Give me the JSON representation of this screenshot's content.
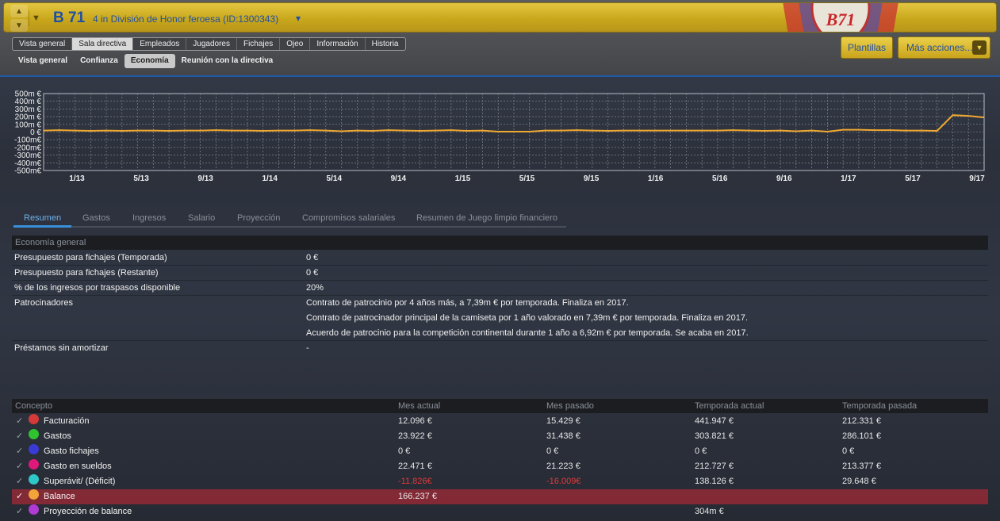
{
  "header": {
    "club_short": "B 71",
    "club_subtitle": "4 in  División de Honor feroesa  (ID:1300343)",
    "crest_text": "B71",
    "buttons": {
      "plantillas": "Plantillas",
      "mas_acciones": "Más acciones..."
    },
    "colors": {
      "title_bar": "#d4b52c",
      "title_text": "#1f4fa6"
    }
  },
  "main_tabs": [
    "Vista general",
    "Sala directiva",
    "Empleados",
    "Jugadores",
    "Fichajes",
    "Ojeo",
    "Información",
    "Historia"
  ],
  "main_tab_active": "Sala directiva",
  "sub_tabs": [
    "Vista general",
    "Confianza",
    "Economía",
    "Reunión con la directiva"
  ],
  "sub_tab_active": "Economía",
  "chart_data": {
    "type": "line",
    "y_ticks": [
      "500m €",
      "400m €",
      "300m €",
      "200m €",
      "100m €",
      "0 €",
      "-100m€",
      "-200m€",
      "-300m€",
      "-400m€",
      "-500m€"
    ],
    "ylim": [
      -500,
      500
    ],
    "y_unit": "m €",
    "x_ticks": [
      "1/13",
      "5/13",
      "9/13",
      "1/14",
      "5/14",
      "9/14",
      "1/15",
      "5/15",
      "9/15",
      "1/16",
      "5/16",
      "9/16",
      "1/17",
      "5/17",
      "9/17"
    ],
    "series": [
      {
        "color": "#f0a830",
        "values": [
          20,
          25,
          20,
          15,
          20,
          15,
          20,
          20,
          15,
          20,
          20,
          25,
          20,
          20,
          15,
          20,
          20,
          25,
          20,
          10,
          20,
          15,
          25,
          20,
          15,
          20,
          25,
          15,
          20,
          5,
          5,
          5,
          20,
          20,
          25,
          20,
          15,
          20,
          20,
          20,
          20,
          20,
          20,
          20,
          25,
          20,
          15,
          20,
          10,
          20,
          5,
          30,
          30,
          25,
          25,
          20,
          20,
          15,
          220,
          210,
          190
        ]
      }
    ],
    "grid": true
  },
  "detail_tabs": [
    "Resumen",
    "Gastos",
    "Ingresos",
    "Salario",
    "Proyección",
    "Compromisos salariales",
    "Resumen de Juego limpio financiero"
  ],
  "detail_tab_active": "Resumen",
  "general": {
    "title": "Economía general",
    "rows": [
      {
        "key": "Presupuesto para fichajes (Temporada)",
        "value": "0 €"
      },
      {
        "key": "Presupuesto para fichajes (Restante)",
        "value": "0 €"
      },
      {
        "key": "% de los ingresos por traspasos disponible",
        "value": "20%"
      },
      {
        "key": "Patrocinadores",
        "value": "Contrato de patrocinio por 4 años más, a 7,39m € por temporada. Finaliza en 2017."
      },
      {
        "key": "",
        "value": "Contrato de patrocinador principal de la camiseta por 1 año valorado en 7,39m € por temporada. Finaliza en 2017."
      },
      {
        "key": "",
        "value": "Acuerdo de patrocinio para la competición continental durante 1 año a 6,92m € por temporada. Se acaba en 2017."
      },
      {
        "key": "Préstamos sin amortizar",
        "value": "-"
      }
    ]
  },
  "concepts": {
    "headers": [
      "Concepto",
      "Mes actual",
      "Mes pasado",
      "Temporada actual",
      "Temporada pasada"
    ],
    "rows": [
      {
        "label": "Facturación",
        "color": "#d43a3a",
        "values": [
          "12.096 €",
          "15.429 €",
          "441.947 €",
          "212.331 €"
        ],
        "negative": [
          false,
          false,
          false,
          false
        ]
      },
      {
        "label": "Gastos",
        "color": "#2fc42f",
        "values": [
          "23.922 €",
          "31.438 €",
          "303.821 €",
          "286.101 €"
        ],
        "negative": [
          false,
          false,
          false,
          false
        ]
      },
      {
        "label": "Gasto fichajes",
        "color": "#3a3ad4",
        "values": [
          "0 €",
          "0 €",
          "0 €",
          "0 €"
        ],
        "negative": [
          false,
          false,
          false,
          false
        ]
      },
      {
        "label": "Gasto en sueldos",
        "color": "#e0187a",
        "values": [
          "22.471 €",
          "21.223 €",
          "212.727 €",
          "213.377 €"
        ],
        "negative": [
          false,
          false,
          false,
          false
        ]
      },
      {
        "label": "Superávit/ (Déficit)",
        "color": "#2ec8c8",
        "values": [
          "-11.826€",
          "-16.009€",
          "138.126 €",
          "29.648 €"
        ],
        "negative": [
          true,
          true,
          false,
          false
        ]
      },
      {
        "label": "Balance",
        "color": "#f2a43a",
        "values": [
          "166.237 €",
          "",
          "",
          ""
        ],
        "negative": [
          false,
          false,
          false,
          false
        ],
        "highlight": true
      },
      {
        "label": "Proyección de balance",
        "color": "#b03ad4",
        "values": [
          "",
          "",
          "304m €",
          ""
        ],
        "negative": [
          false,
          false,
          false,
          false
        ]
      }
    ]
  }
}
